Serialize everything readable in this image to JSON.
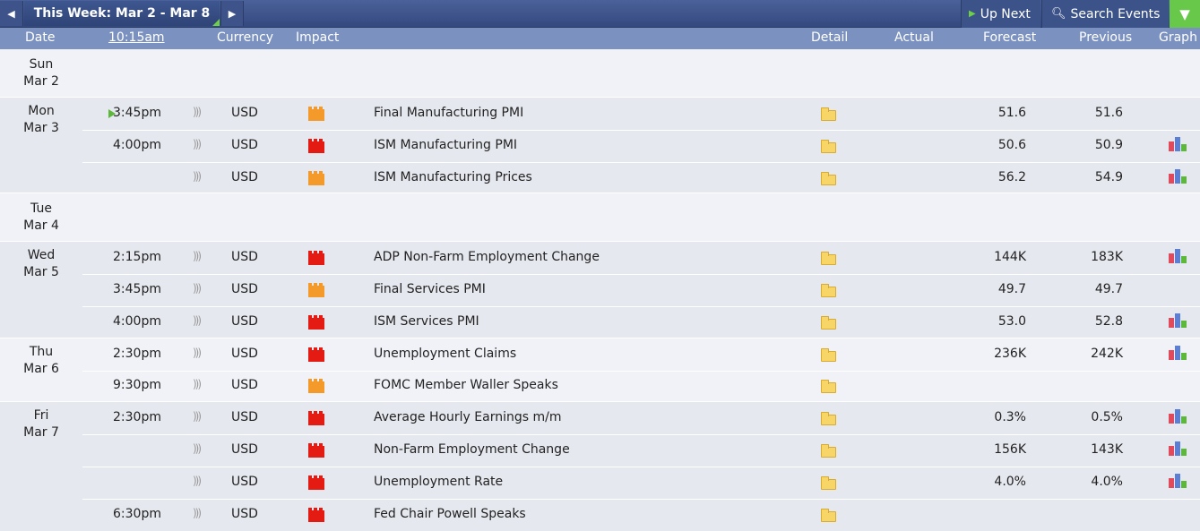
{
  "toolbar": {
    "prev_icon": "chevron-left-icon",
    "week_label": "This Week: Mar 2 - Mar 8",
    "next_icon": "chevron-right-icon",
    "up_next_label": "Up Next",
    "search_label": "Search Events",
    "filter_icon": "filter-icon"
  },
  "header": {
    "date": "Date",
    "time": "10:15am",
    "currency": "Currency",
    "impact": "Impact",
    "detail": "Detail",
    "actual": "Actual",
    "forecast": "Forecast",
    "previous": "Previous",
    "graph": "Graph"
  },
  "colors": {
    "high_impact": "#e31b12",
    "medium_impact": "#f39a2b",
    "header_bg": "#7b91bf",
    "toolbar_bg": "#3c5389",
    "accent_green": "#68c84a"
  },
  "days": [
    {
      "weekday": "Sun",
      "date": "Mar 2",
      "events": []
    },
    {
      "weekday": "Mon",
      "date": "Mar 3",
      "events": [
        {
          "time": "3:45pm",
          "currency": "USD",
          "impact": "medium",
          "name": "Final Manufacturing PMI",
          "forecast": "51.6",
          "previous": "51.6",
          "graph": false,
          "next": true
        },
        {
          "time": "4:00pm",
          "currency": "USD",
          "impact": "high",
          "name": "ISM Manufacturing PMI",
          "forecast": "50.6",
          "previous": "50.9",
          "graph": true
        },
        {
          "time": "",
          "currency": "USD",
          "impact": "medium",
          "name": "ISM Manufacturing Prices",
          "forecast": "56.2",
          "previous": "54.9",
          "graph": true
        }
      ]
    },
    {
      "weekday": "Tue",
      "date": "Mar 4",
      "events": []
    },
    {
      "weekday": "Wed",
      "date": "Mar 5",
      "events": [
        {
          "time": "2:15pm",
          "currency": "USD",
          "impact": "high",
          "name": "ADP Non-Farm Employment Change",
          "forecast": "144K",
          "previous": "183K",
          "graph": true
        },
        {
          "time": "3:45pm",
          "currency": "USD",
          "impact": "medium",
          "name": "Final Services PMI",
          "forecast": "49.7",
          "previous": "49.7",
          "graph": false
        },
        {
          "time": "4:00pm",
          "currency": "USD",
          "impact": "high",
          "name": "ISM Services PMI",
          "forecast": "53.0",
          "previous": "52.8",
          "graph": true
        }
      ]
    },
    {
      "weekday": "Thu",
      "date": "Mar 6",
      "events": [
        {
          "time": "2:30pm",
          "currency": "USD",
          "impact": "high",
          "name": "Unemployment Claims",
          "forecast": "236K",
          "previous": "242K",
          "graph": true
        },
        {
          "time": "9:30pm",
          "currency": "USD",
          "impact": "medium",
          "name": "FOMC Member Waller Speaks",
          "forecast": "",
          "previous": "",
          "graph": false
        }
      ]
    },
    {
      "weekday": "Fri",
      "date": "Mar 7",
      "events": [
        {
          "time": "2:30pm",
          "currency": "USD",
          "impact": "high",
          "name": "Average Hourly Earnings m/m",
          "forecast": "0.3%",
          "previous": "0.5%",
          "graph": true
        },
        {
          "time": "",
          "currency": "USD",
          "impact": "high",
          "name": "Non-Farm Employment Change",
          "forecast": "156K",
          "previous": "143K",
          "graph": true
        },
        {
          "time": "",
          "currency": "USD",
          "impact": "high",
          "name": "Unemployment Rate",
          "forecast": "4.0%",
          "previous": "4.0%",
          "graph": true
        },
        {
          "time": "6:30pm",
          "currency": "USD",
          "impact": "high",
          "name": "Fed Chair Powell Speaks",
          "forecast": "",
          "previous": "",
          "graph": false
        }
      ]
    }
  ]
}
